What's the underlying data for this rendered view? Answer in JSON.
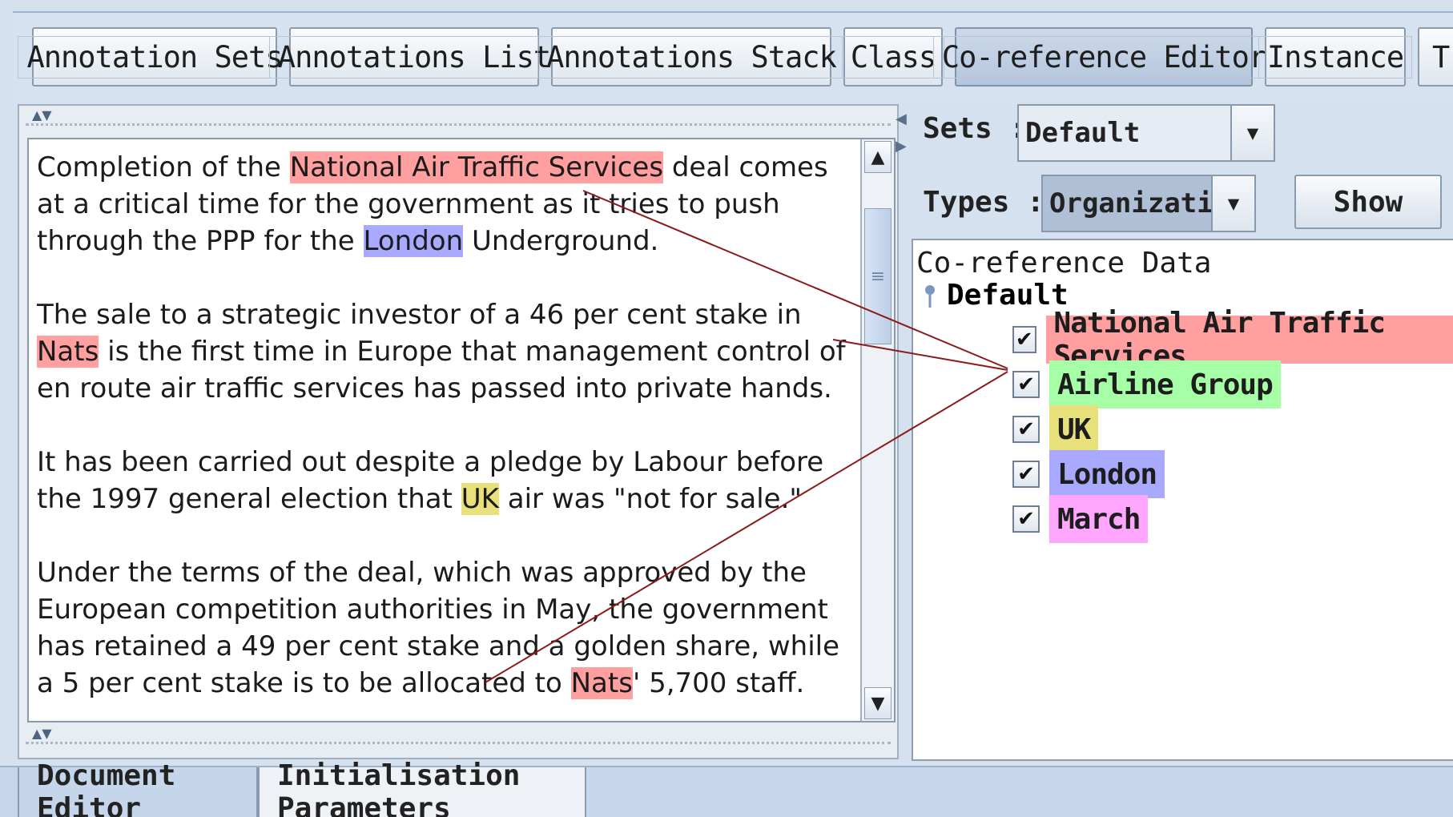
{
  "toolbar": {
    "tabs": [
      {
        "label": "Annotation Sets"
      },
      {
        "label": "Annotations List"
      },
      {
        "label": "Annotations Stack"
      },
      {
        "label": "Class"
      },
      {
        "label": "Co-reference Editor"
      },
      {
        "label": "Instance"
      },
      {
        "label": "T"
      }
    ],
    "active": "Co-reference Editor"
  },
  "document": {
    "paragraphs": [
      [
        {
          "text": "Completion of the "
        },
        {
          "text": "National Air Traffic Services",
          "hl": "red"
        },
        {
          "text": " deal comes at a critical time for the government as it tries to push through the PPP for the "
        },
        {
          "text": "London",
          "hl": "blue"
        },
        {
          "text": " Underground."
        }
      ],
      [
        {
          "text": "The sale to a strategic investor of a 46 per cent stake in "
        },
        {
          "text": "Nats",
          "hl": "red"
        },
        {
          "text": " is the first time in Europe that management control of en route air traffic services has passed into private hands."
        }
      ],
      [
        {
          "text": "It has been carried out despite a pledge by Labour before the 1997 general election that "
        },
        {
          "text": "UK",
          "hl": "yellow"
        },
        {
          "text": " air was \"not for sale.\""
        }
      ],
      [
        {
          "text": "Under the terms of the deal, which was approved by the European competition authorities in May, the government has retained a 49 per cent stake and a golden share, while a 5 per cent stake is to be allocated to "
        },
        {
          "text": "Nats",
          "hl": "red"
        },
        {
          "text": "' 5,700 staff."
        }
      ]
    ]
  },
  "right_panel": {
    "sets_label": "Sets :",
    "sets_value": "Default",
    "types_label": "Types :",
    "types_value": "Organization",
    "show_label": "Show",
    "coref_title": "Co-reference Data",
    "root_label": "Default",
    "chains": [
      {
        "label": "National Air Traffic Services",
        "color": "#ff9f9f",
        "checked": "✔"
      },
      {
        "label": "Airline Group",
        "color": "#a6ffa6",
        "checked": "✔"
      },
      {
        "label": "UK",
        "color": "#e8e07a",
        "checked": "✔"
      },
      {
        "label": "London",
        "color": "#a9a9ff",
        "checked": "✔"
      },
      {
        "label": "March",
        "color": "#ffa6ff",
        "checked": "✔"
      }
    ]
  },
  "bottom_tabs": [
    {
      "label": "Document Editor",
      "selected": true
    },
    {
      "label": "Initialisation Parameters",
      "selected": false
    }
  ],
  "colors": {
    "highlight_red": "#ff9f9f",
    "highlight_blue": "#a9a9ff",
    "highlight_yellow": "#e8e07a",
    "link_line": "#8b1a1a"
  }
}
